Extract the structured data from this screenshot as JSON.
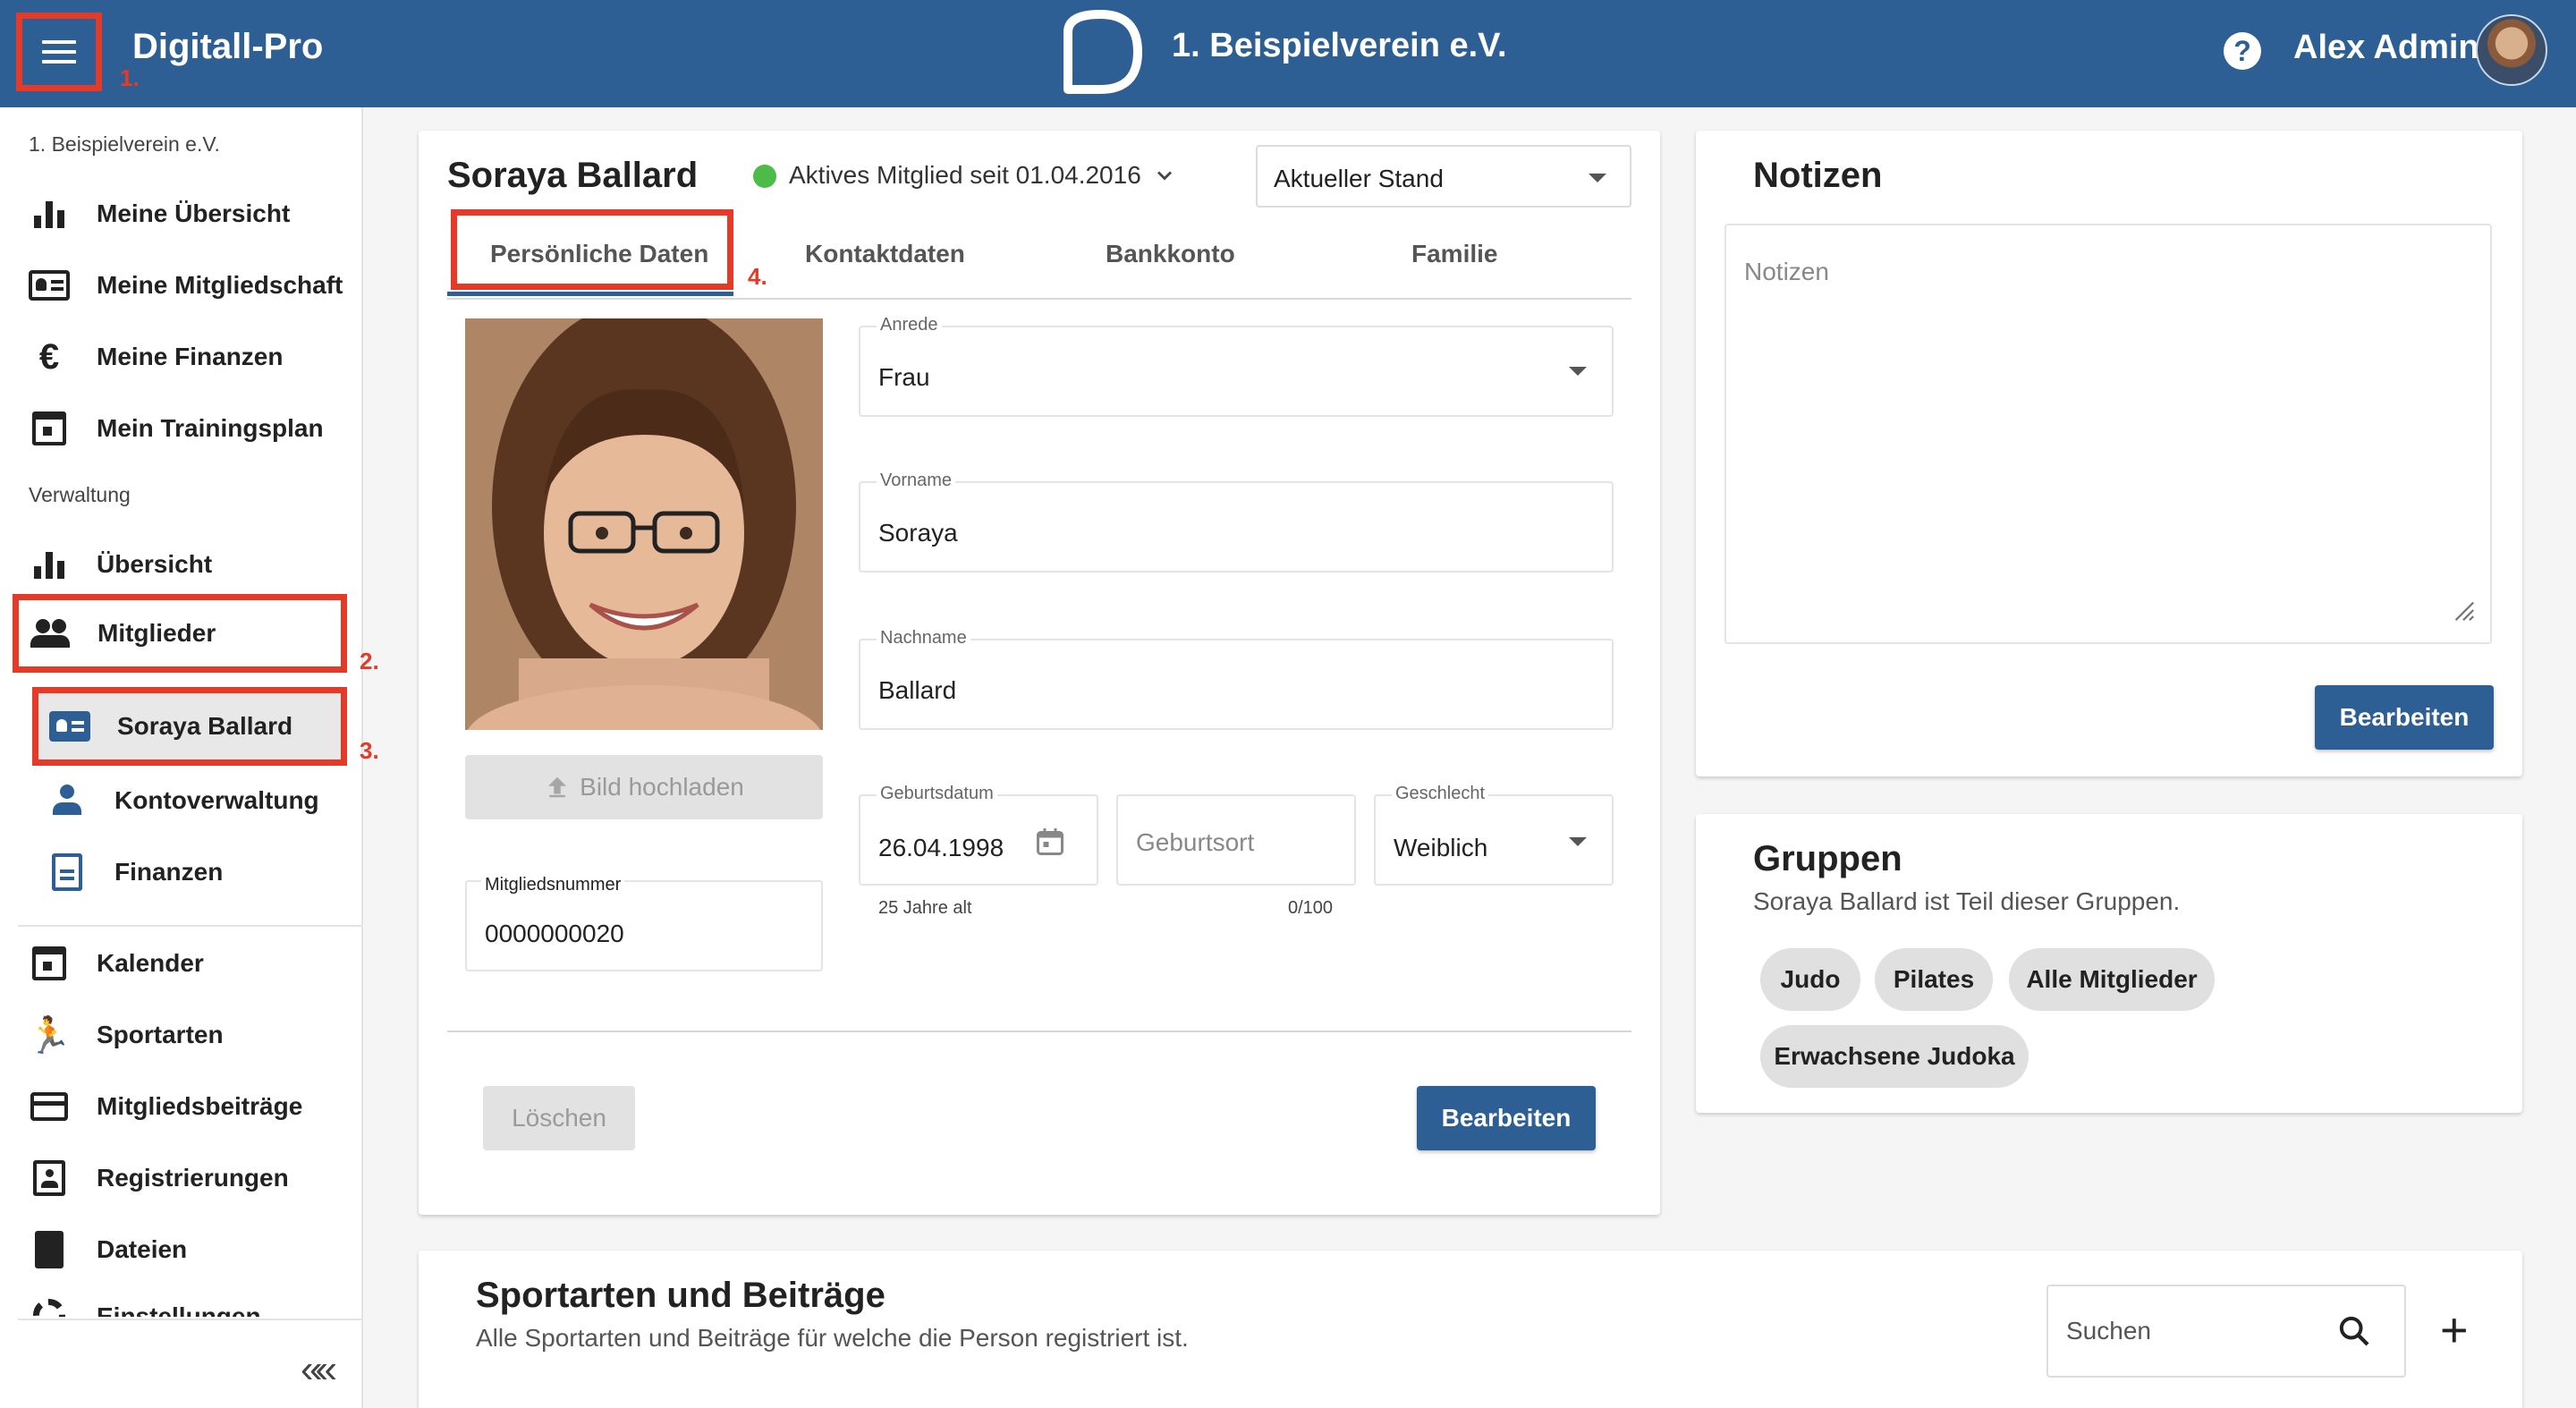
{
  "header": {
    "app_title": "Digitall-Pro",
    "club_name": "1. Beispielverein e.V.",
    "help_glyph": "?",
    "user_name": "Alex Admin",
    "menu_icon": "hamburger-menu-icon",
    "bar_color": "#2e5f94",
    "annotation_color": "#e53a28"
  },
  "annotations": [
    "1.",
    "2.",
    "3.",
    "4."
  ],
  "sidebar": {
    "club_label": "1. Beispielverein e.V.",
    "admin_label": "Verwaltung",
    "personal_items": [
      {
        "label": "Meine Übersicht",
        "icon": "bar-chart-icon"
      },
      {
        "label": "Meine Mitgliedschaft",
        "icon": "id-card-icon"
      },
      {
        "label": "Meine Finanzen",
        "icon": "euro-icon"
      },
      {
        "label": "Mein Trainingsplan",
        "icon": "calendar-event-icon"
      }
    ],
    "admin_items": [
      {
        "label": "Übersicht",
        "icon": "bar-chart-icon"
      },
      {
        "label": "Mitglieder",
        "icon": "people-icon"
      },
      {
        "label": "Soraya Ballard",
        "icon": "id-card-icon",
        "selected": true
      },
      {
        "label": "Kontoverwaltung",
        "icon": "person-icon"
      },
      {
        "label": "Finanzen",
        "icon": "document-icon"
      }
    ],
    "other_items": [
      {
        "label": "Kalender",
        "icon": "calendar-icon"
      },
      {
        "label": "Sportarten",
        "icon": "sports-icon"
      },
      {
        "label": "Mitgliedsbeiträge",
        "icon": "credit-card-icon"
      },
      {
        "label": "Registrierungen",
        "icon": "badge-icon"
      },
      {
        "label": "Dateien",
        "icon": "files-icon"
      },
      {
        "label": "Einstellungen",
        "icon": "gear-icon"
      }
    ],
    "collapse_glyph": "«"
  },
  "member": {
    "name": "Soraya Ballard",
    "status_text": "Aktives Mitglied seit 01.04.2016",
    "status_color": "#4cbb47",
    "stand_select": "Aktueller Stand",
    "tabs": [
      "Persönliche Daten",
      "Kontaktdaten",
      "Bankkonto",
      "Familie"
    ],
    "upload_label": "Bild hochladen",
    "fields": {
      "anrede": {
        "label": "Anrede",
        "value": "Frau"
      },
      "vorname": {
        "label": "Vorname",
        "value": "Soraya"
      },
      "nachname": {
        "label": "Nachname",
        "value": "Ballard"
      },
      "geburtsdatum": {
        "label": "Geburtsdatum",
        "value": "26.04.1998",
        "hint": "25 Jahre alt"
      },
      "geburtsort": {
        "placeholder": "Geburtsort",
        "counter": "0/100"
      },
      "geschlecht": {
        "label": "Geschlecht",
        "value": "Weiblich"
      },
      "mitgliedsnummer": {
        "label": "Mitgliedsnummer",
        "value": "0000000020"
      }
    },
    "delete_label": "Löschen",
    "edit_label": "Bearbeiten"
  },
  "notes": {
    "title": "Notizen",
    "placeholder": "Notizen",
    "edit_label": "Bearbeiten"
  },
  "groups": {
    "title": "Gruppen",
    "subtitle": "Soraya Ballard ist Teil dieser Gruppen.",
    "chips": [
      "Judo",
      "Pilates",
      "Alle Mitglieder",
      "Erwachsene Judoka"
    ]
  },
  "sports": {
    "title": "Sportarten und Beiträge",
    "subtitle": "Alle Sportarten und Beiträge für welche die Person registriert ist.",
    "search_placeholder": "Suchen",
    "add_glyph": "+"
  }
}
